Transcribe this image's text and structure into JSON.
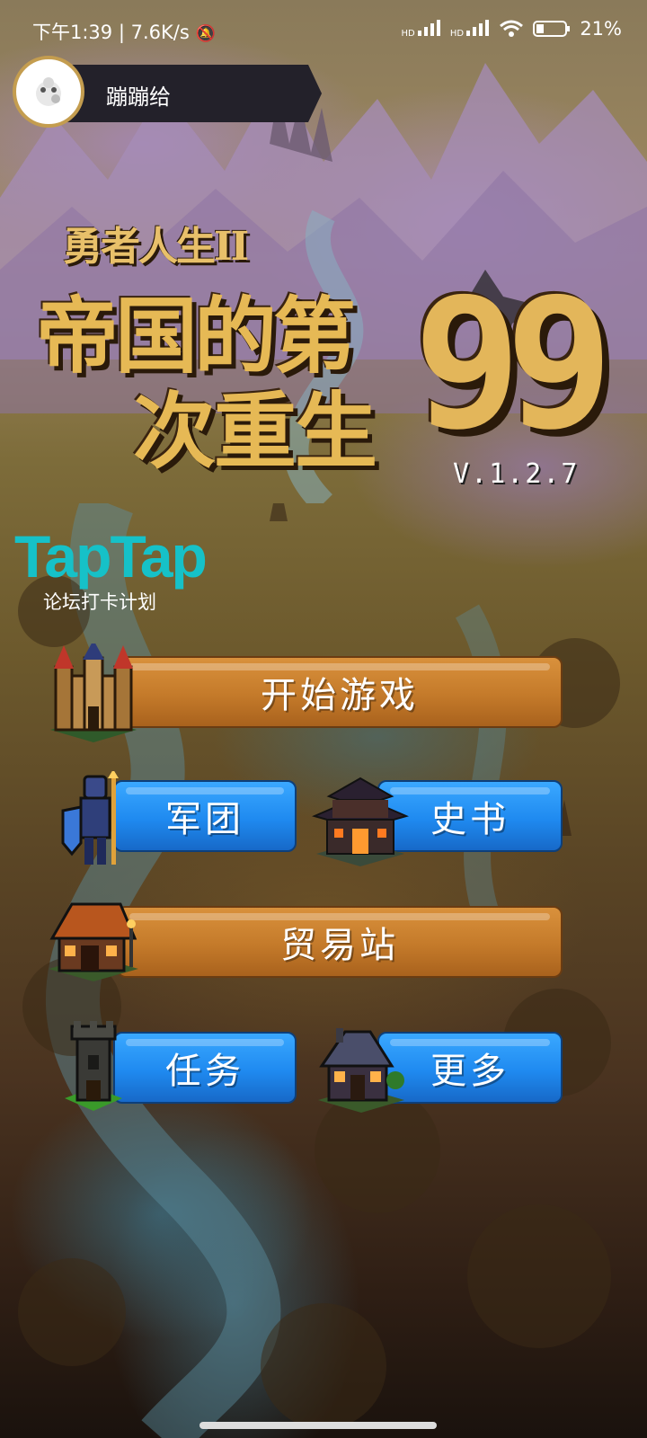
{
  "status_bar": {
    "time": "下午1:39",
    "speed": "7.6K/s",
    "battery": "21%",
    "hd1": "HD",
    "hd2": "HD"
  },
  "profile": {
    "name": "蹦蹦给"
  },
  "title": {
    "small": "勇者人生II",
    "line1": "帝国的第",
    "line2": "次重生",
    "number": "99",
    "version": "V.1.2.7"
  },
  "taptap": {
    "logo": "TapTap",
    "subtitle": "论坛打卡计划"
  },
  "menu": {
    "start": "开始游戏",
    "legion": "军团",
    "history": "史书",
    "trade": "贸易站",
    "quest": "任务",
    "more": "更多"
  },
  "colors": {
    "orange_button": "#c47a2a",
    "blue_button": "#1f8af0",
    "taptap": "#16c1c8",
    "title_gold": "#e6b955"
  },
  "icons": {
    "start": "castle-icon",
    "legion": "knight-icon",
    "history": "pagoda-icon",
    "trade": "shop-icon",
    "quest": "tower-icon",
    "more": "house-icon"
  }
}
